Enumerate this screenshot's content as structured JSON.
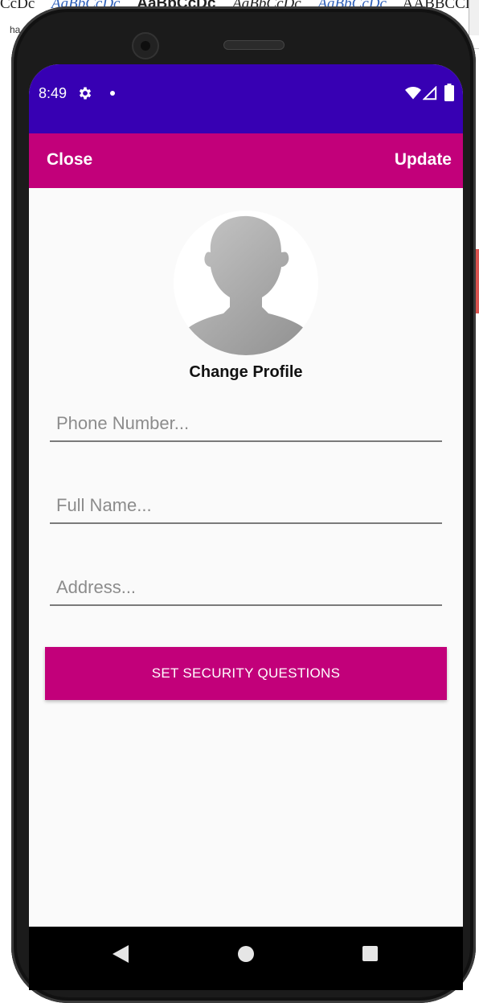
{
  "background": {
    "style_samples": [
      "AaBbCcDc",
      "AaBbCcDc",
      "AaBbCcDc",
      "AaBbCcDc",
      "AaBbCcDc",
      "AABBCCDE"
    ],
    "style_prefix": "CcDc",
    "subtext": "ha"
  },
  "status_bar": {
    "time": "8:49",
    "color": "#3700b3"
  },
  "app_bar": {
    "close_label": "Close",
    "update_label": "Update",
    "color": "#c2007a"
  },
  "profile": {
    "change_label": "Change Profile",
    "avatar_icon": "person-silhouette-icon"
  },
  "form": {
    "phone_placeholder": "Phone Number...",
    "name_placeholder": "Full Name...",
    "address_placeholder": "Address...",
    "security_button_label": "SET SECURITY QUESTIONS"
  },
  "nav_bar": {
    "back_icon": "back-triangle-icon",
    "home_icon": "home-circle-icon",
    "recent_icon": "recent-square-icon"
  }
}
